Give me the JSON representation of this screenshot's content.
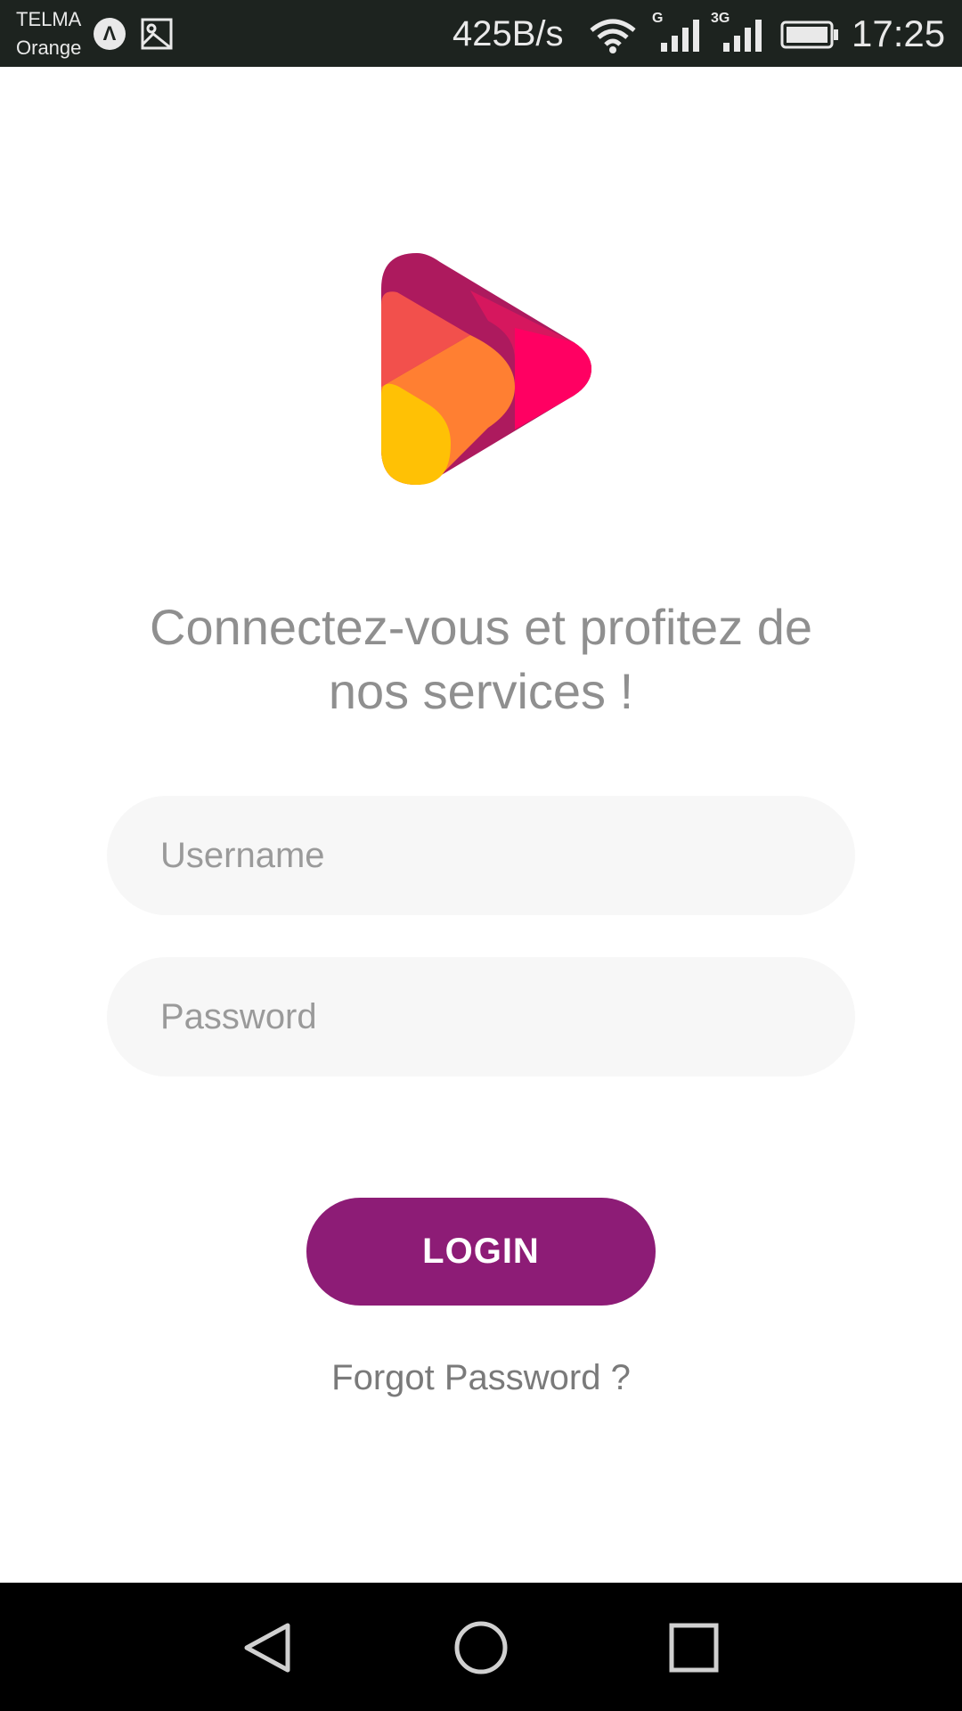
{
  "status_bar": {
    "carrier_line1": "TELMA",
    "carrier_line2": "Orange",
    "app_icon_letter": "Λ",
    "net_speed": "425B/s",
    "signal1_label": "G",
    "signal2_label": "3G",
    "time": "17:25",
    "icons": [
      "app-icon",
      "image-icon",
      "wifi-icon",
      "signal-icon",
      "signal-3g-icon",
      "battery-icon"
    ]
  },
  "main": {
    "headline_line1": "Connectez-vous et profitez de",
    "headline_line2": "nos services !",
    "username_placeholder": "Username",
    "password_placeholder": "Password",
    "login_label": "LOGIN",
    "forgot_label": "Forgot Password ?"
  },
  "nav_bar": {
    "icons": [
      "back-icon",
      "home-icon",
      "recents-icon"
    ]
  },
  "colors": {
    "status_bar": "#1d231f",
    "login_button": "#8d1c76",
    "headline_text": "#8f8f8f",
    "field_background": "#f7f7f7",
    "logo": [
      "#ad1a5e",
      "#d6175e",
      "#ff0062",
      "#f2504c",
      "#ff7f32",
      "#ffc105"
    ]
  }
}
